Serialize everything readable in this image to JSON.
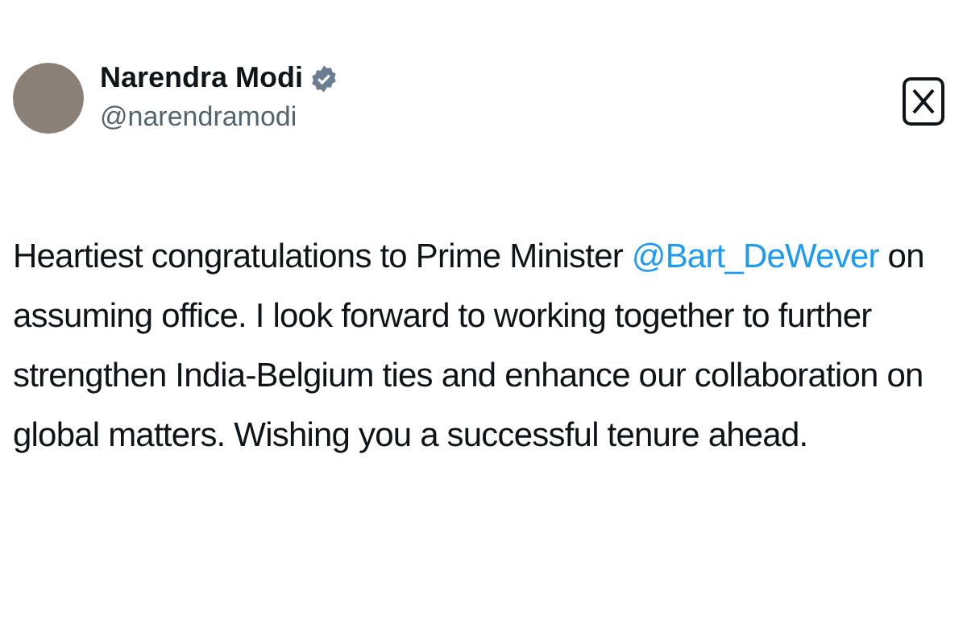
{
  "author": {
    "name": "Narendra Modi",
    "handle": "@narendramodi",
    "verified": true
  },
  "post": {
    "segments": [
      {
        "kind": "text",
        "text": "Heartiest congratulations to Prime Minister "
      },
      {
        "kind": "mention",
        "text": "@Bart_DeWever"
      },
      {
        "kind": "text",
        "text": " on assuming office. I look forward to working together to further strengthen India-Belgium ties and enhance our collaboration on global matters. Wishing you a successful tenure ahead."
      }
    ]
  }
}
